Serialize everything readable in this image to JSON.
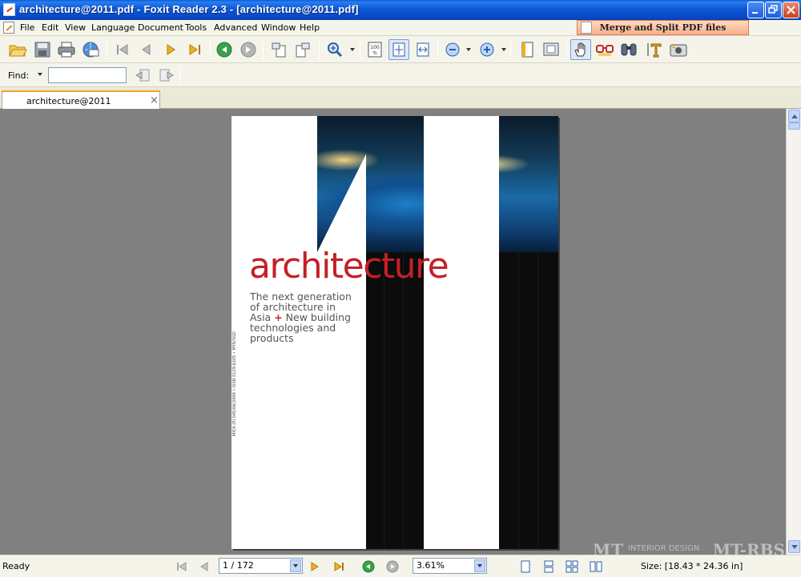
{
  "window": {
    "title": "architecture@2011.pdf - Foxit Reader 2.3 - [architecture@2011.pdf]"
  },
  "menu": {
    "items": [
      "File",
      "Edit",
      "View",
      "Language",
      "Document",
      "Tools",
      "Advanced",
      "Window",
      "Help"
    ],
    "promo_label": "Merge and Split PDF files"
  },
  "toolbar": {
    "icons": [
      "open-folder-icon",
      "save-icon",
      "print-icon",
      "email-icon",
      "first-page-icon",
      "previous-page-icon",
      "next-page-icon",
      "last-page-icon",
      "go-back-icon",
      "go-forward-icon",
      "rotate-left-icon",
      "rotate-right-icon",
      "zoom-in-tool-icon",
      "actual-size-icon",
      "fit-page-icon",
      "fit-width-icon",
      "zoom-out-icon",
      "zoom-in-icon",
      "single-page-icon",
      "full-screen-icon",
      "hand-tool-icon",
      "reading-glasses-icon",
      "find-icon",
      "text-select-icon",
      "snapshot-icon"
    ]
  },
  "find": {
    "label": "Find:",
    "value": ""
  },
  "tabs": [
    {
      "label": "architecture@2011"
    }
  ],
  "document": {
    "cover_title_red": "archit",
    "cover_title_white": "ecture",
    "cover_title_red2": "",
    "cover_title_at": "@",
    "subtitle_line1": "The next generation",
    "subtitle_line2": "of architecture in",
    "subtitle_asia": "Asia",
    "subtitle_plus": "+",
    "subtitle_line3": "New building",
    "subtitle_line4": "technologies and",
    "subtitle_line5": "products",
    "spine_text": "MICA (P) 045/06/2009 • ISSN 0129-6205 • MYR/SGD"
  },
  "status": {
    "text": "Ready",
    "page_value": "1 / 172",
    "zoom_value": "3.61%",
    "size_text": "Size: [18.43 * 24.36 in]"
  },
  "watermark": {
    "mt": "MT",
    "sub": "INTERIOR DESIGN",
    "rbs": "_MT-RBS"
  },
  "colors": {
    "title_bar": "#0b58d6",
    "brand_red": "#c42026",
    "viewer_bg": "#808080"
  }
}
